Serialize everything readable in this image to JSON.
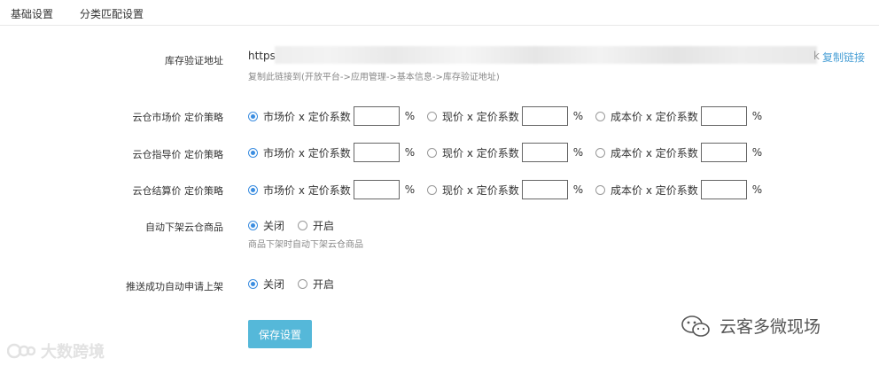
{
  "tabs": [
    {
      "label": "基础设置"
    },
    {
      "label": "分类匹配设置"
    }
  ],
  "inventory": {
    "label": "库存验证地址",
    "url_prefix": "https:",
    "url_suffix": "k",
    "copy_label": "复制链接",
    "help": "复制此链接到(开放平台->应用管理->基本信息->库存验证地址)"
  },
  "pricing_rows": [
    {
      "label": "云仓市场价 定价策略",
      "options": [
        {
          "text": "市场价 x 定价系数",
          "checked": true,
          "value": "",
          "unit": "%"
        },
        {
          "text": "现价 x 定价系数",
          "checked": false,
          "value": "",
          "unit": "%"
        },
        {
          "text": "成本价 x 定价系数",
          "checked": false,
          "value": "",
          "unit": "%"
        }
      ]
    },
    {
      "label": "云仓指导价 定价策略",
      "options": [
        {
          "text": "市场价 x 定价系数",
          "checked": true,
          "value": "",
          "unit": "%"
        },
        {
          "text": "现价 x 定价系数",
          "checked": false,
          "value": "",
          "unit": "%"
        },
        {
          "text": "成本价 x 定价系数",
          "checked": false,
          "value": "",
          "unit": "%"
        }
      ]
    },
    {
      "label": "云仓结算价 定价策略",
      "options": [
        {
          "text": "市场价 x 定价系数",
          "checked": true,
          "value": "",
          "unit": "%"
        },
        {
          "text": "现价 x 定价系数",
          "checked": false,
          "value": "",
          "unit": "%"
        },
        {
          "text": "成本价 x 定价系数",
          "checked": false,
          "value": "",
          "unit": "%"
        }
      ]
    }
  ],
  "auto_delist": {
    "label": "自动下架云仓商品",
    "off": "关闭",
    "on": "开启",
    "help": "商品下架时自动下架云仓商品"
  },
  "auto_listing": {
    "label": "推送成功自动申请上架",
    "off": "关闭",
    "on": "开启"
  },
  "save_label": "保存设置",
  "watermarks": {
    "left": "大数跨境",
    "right": "云客多微现场"
  },
  "colors": {
    "accent": "#3b8de0",
    "link": "#4aa0d6",
    "button": "#55b8d9"
  }
}
